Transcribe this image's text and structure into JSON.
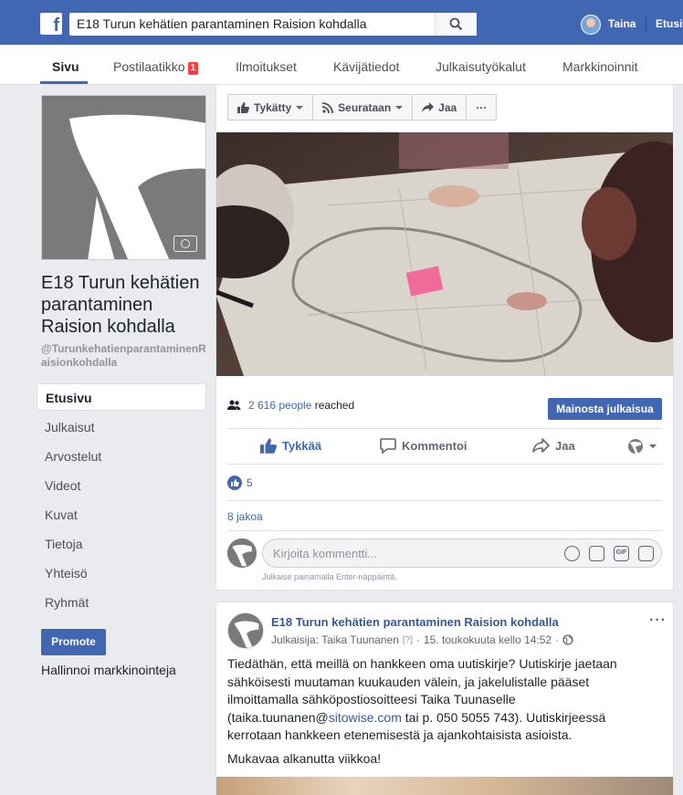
{
  "header": {
    "search_value": "E18 Turun kehätien parantaminen Raision kohdalla",
    "user_name": "Taina",
    "home_label": "Etusivu",
    "logo_letter": "f"
  },
  "tabs": {
    "page": "Sivu",
    "inbox": "Postilaatikko",
    "inbox_count": "1",
    "notifications": "Ilmoitukset",
    "visitors": "Kävijätiedot",
    "publishing": "Julkaisutyökalut",
    "marketing": "Markkinoinnit"
  },
  "page": {
    "title": "E18 Turun kehätien parantaminen Raision kohdalla",
    "handle": "@TurunkehatienparantaminenRaisionkohdalla"
  },
  "sidebar": {
    "items": [
      {
        "label": "Etusivu"
      },
      {
        "label": "Julkaisut"
      },
      {
        "label": "Arvostelut"
      },
      {
        "label": "Videot"
      },
      {
        "label": "Kuvat"
      },
      {
        "label": "Tietoja"
      },
      {
        "label": "Yhteisö"
      },
      {
        "label": "Ryhmät"
      }
    ],
    "promote": "Promote",
    "manage": "Hallinnoi markkinointeja"
  },
  "page_actions": {
    "liked": "Tykätty",
    "following": "Seurataan",
    "share": "Jaa",
    "more": "···"
  },
  "post1": {
    "reach_count": "2 616 people",
    "reach_suffix": "reached",
    "boost": "Mainosta julkaisua",
    "like": "Tykkää",
    "comment": "Kommentoi",
    "share": "Jaa",
    "like_count": "5",
    "shares": "8 jakoa",
    "comment_placeholder": "Kirjoita kommentti...",
    "enter_hint": "Julkaise painamalla Enter-näppäintä.",
    "gif_label": "GIF"
  },
  "post2": {
    "author": "E18 Turun kehätien parantaminen Raision kohdalla",
    "publisher": "Julkaisija: Taika Tuunanen",
    "publisher_help": "[?]",
    "date": "15. toukokuuta kello 14:52",
    "sep": "·",
    "more": "···",
    "body1_a": "Tiedäthän, että meillä on hankkeen oma uutiskirje? Uutiskirje jaetaan sähköisesti muutaman kuukauden välein, ja jakelulistalle pääset ilmoittamalla sähköpostiosoitteesi Taika Tuunaselle (taika.tuunanen@",
    "body1_link": "sitowise.com",
    "body1_b": " tai p. 050 5055 743). Uutiskirjeessä kerrotaan hankkeen etenemisestä ja ajankohtaisista asioista.",
    "body2": "Mukavaa alkanutta viikkoa!"
  },
  "colors": {
    "brand": "#4267b2",
    "link": "#365899",
    "background": "#e9ebee",
    "badge": "#fa3e3e"
  }
}
